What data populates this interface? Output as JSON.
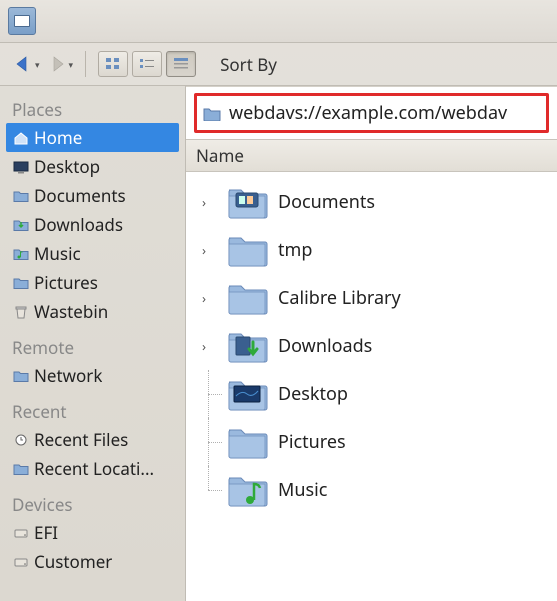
{
  "toolbar": {
    "sort_label": "Sort By"
  },
  "address": {
    "path": "webdavs://example.com/webdav"
  },
  "columns": {
    "name": "Name"
  },
  "sidebar": {
    "sections": [
      {
        "heading": "Places",
        "items": [
          {
            "label": "Home",
            "icon": "home",
            "selected": true
          },
          {
            "label": "Desktop",
            "icon": "desktop"
          },
          {
            "label": "Documents",
            "icon": "folder"
          },
          {
            "label": "Downloads",
            "icon": "download"
          },
          {
            "label": "Music",
            "icon": "music"
          },
          {
            "label": "Pictures",
            "icon": "pictures"
          },
          {
            "label": "Wastebin",
            "icon": "trash"
          }
        ]
      },
      {
        "heading": "Remote",
        "items": [
          {
            "label": "Network",
            "icon": "network"
          }
        ]
      },
      {
        "heading": "Recent",
        "items": [
          {
            "label": "Recent Files",
            "icon": "recent"
          },
          {
            "label": "Recent Locati...",
            "icon": "folder"
          }
        ]
      },
      {
        "heading": "Devices",
        "items": [
          {
            "label": "EFI",
            "icon": "drive"
          },
          {
            "label": "Customer",
            "icon": "drive"
          }
        ]
      }
    ]
  },
  "files": [
    {
      "name": "Documents",
      "kind": "documents",
      "expandable": true
    },
    {
      "name": "tmp",
      "kind": "folder",
      "expandable": true
    },
    {
      "name": "Calibre Library",
      "kind": "folder",
      "expandable": true
    },
    {
      "name": "Downloads",
      "kind": "downloads",
      "expandable": true
    },
    {
      "name": "Desktop",
      "kind": "desktop",
      "expandable": false
    },
    {
      "name": "Pictures",
      "kind": "folder",
      "expandable": false
    },
    {
      "name": "Music",
      "kind": "music",
      "expandable": false
    }
  ]
}
